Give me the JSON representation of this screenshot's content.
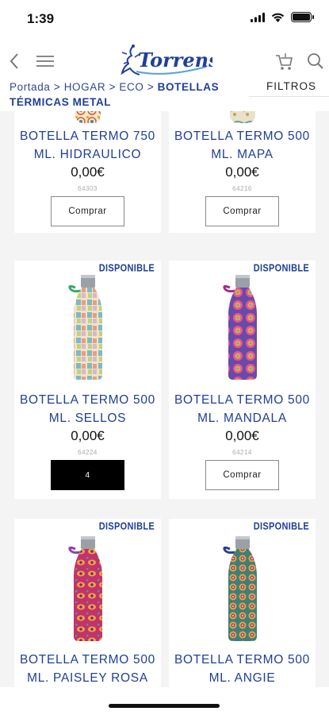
{
  "status_bar": {
    "time": "1:39"
  },
  "header": {
    "brand": "Torrens"
  },
  "breadcrumb": {
    "items": [
      "Portada",
      "HOGAR",
      "ECO"
    ],
    "current": "BOTELLAS TÉRMICAS METAL",
    "separator": ">"
  },
  "filters_label": "FILTROS",
  "colors": {
    "brand_blue": "#1f3f99",
    "background": "#f4f4f4",
    "qty_button": "#000000"
  },
  "products": [
    {
      "name": "BOTELLA TERMO 750 ML. HIDRAULICO",
      "price": "0,00€",
      "sku": "64303",
      "button": "Comprar",
      "badge": ""
    },
    {
      "name": "BOTELLA TERMO 500 ML. MAPA",
      "price": "0,00€",
      "sku": "64216",
      "button": "Comprar",
      "badge": ""
    },
    {
      "name": "BOTELLA TERMO 500 ML. SELLOS",
      "price": "0,00€",
      "sku": "64224",
      "button": "4",
      "badge": "DISPONIBLE"
    },
    {
      "name": "BOTELLA TERMO 500 ML. MANDALA",
      "price": "0,00€",
      "sku": "64214",
      "button": "Comprar",
      "badge": "DISPONIBLE"
    },
    {
      "name": "BOTELLA TERMO 500 ML. PAISLEY ROSA",
      "badge": "DISPONIBLE"
    },
    {
      "name": "BOTELLA TERMO 500 ML. ANGIE",
      "badge": "DISPONIBLE"
    }
  ]
}
